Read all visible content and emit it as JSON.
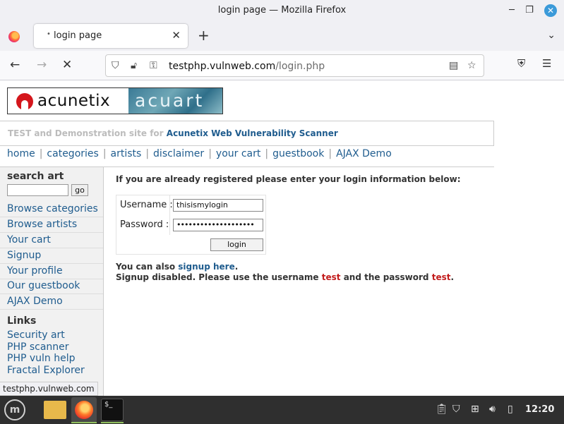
{
  "window": {
    "title": "login page — Mozilla Firefox"
  },
  "tabs": [
    {
      "label": "login page"
    }
  ],
  "url": {
    "host": "testphp.vulnweb.com",
    "path": "/login.php"
  },
  "site": {
    "logo_left": "acunetix",
    "logo_right": "acuart",
    "tagline_prefix": "TEST and Demonstration site for",
    "tagline_brand": "Acunetix Web Vulnerability Scanner",
    "topnav": [
      "home",
      "categories",
      "artists",
      "disclaimer",
      "your cart",
      "guestbook",
      "AJAX Demo"
    ]
  },
  "sidebar": {
    "search_title": "search art",
    "search_button": "go",
    "links": [
      "Browse categories",
      "Browse artists",
      "Your cart",
      "Signup",
      "Your profile",
      "Our guestbook",
      "AJAX Demo"
    ],
    "links_title": "Links",
    "extra_links": [
      "Security art",
      "PHP scanner",
      "PHP vuln help",
      "Fractal Explorer"
    ]
  },
  "login": {
    "intro": "If you are already registered please enter your login information below:",
    "username_label": "Username :",
    "username_value": "thisismylogin",
    "password_label": "Password :",
    "password_value": "••••••••••••••••••••",
    "button": "login",
    "signup_prefix": "You can also",
    "signup_link": "signup here",
    "signup_suffix": ".",
    "disabled_prefix": "Signup disabled. Please use the username",
    "disabled_user": "test",
    "disabled_mid": "and the password",
    "disabled_pass": "test",
    "disabled_suffix": "."
  },
  "statusbar": "testphp.vulnweb.com",
  "taskbar": {
    "clock": "12:20"
  }
}
